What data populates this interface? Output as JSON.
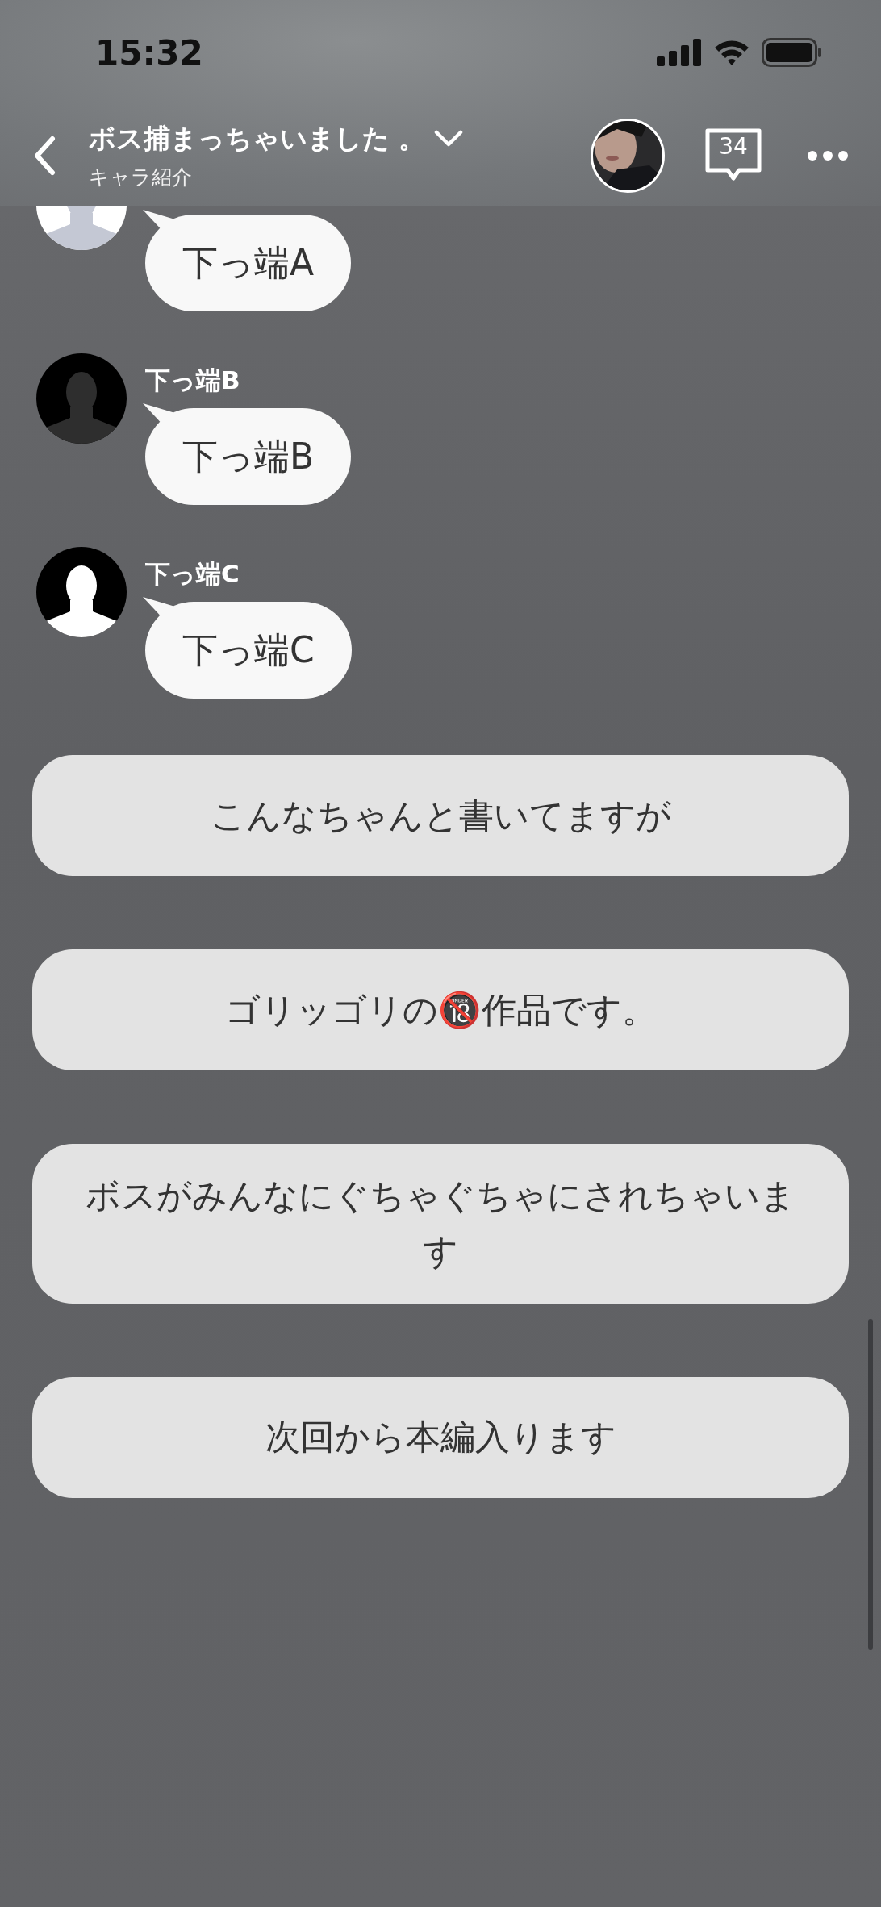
{
  "status_bar": {
    "time": "15:32"
  },
  "header": {
    "title": "ボス捕まっちゃいました 。",
    "subtitle": "キャラ紹介",
    "comment_count": "34"
  },
  "messages": [
    {
      "kind": "light",
      "text": "下っ端A"
    },
    {
      "kind": "dark",
      "name": "下っ端B",
      "text": "下っ端B"
    },
    {
      "kind": "black",
      "name": "下っ端C",
      "text": "下っ端C"
    }
  ],
  "choices": [
    "こんなちゃんと書いてますが",
    "ゴリッゴリの🔞作品です。",
    "ボスがみんなにぐちゃぐちゃにされちゃいます",
    "次回から本編入ります"
  ]
}
